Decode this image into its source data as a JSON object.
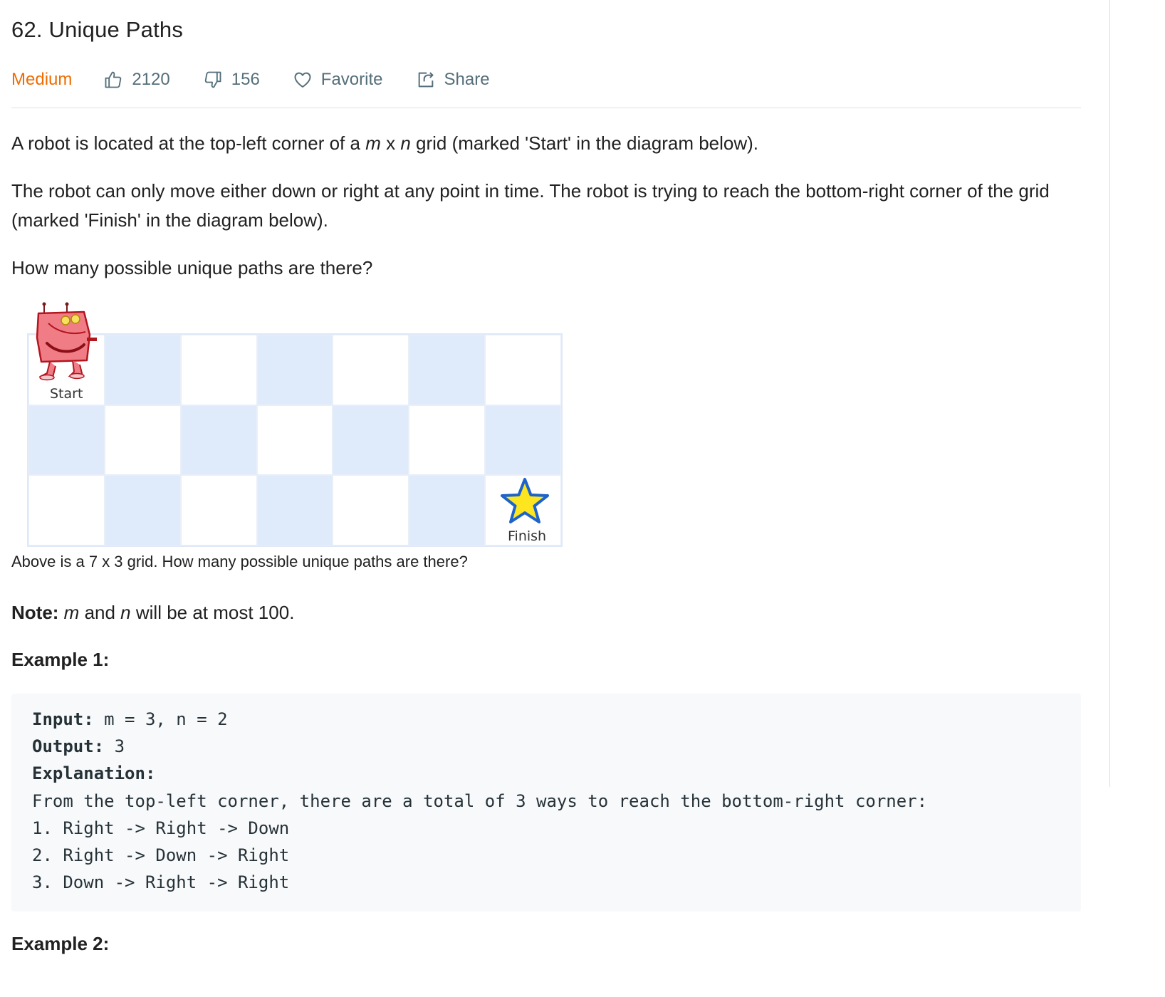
{
  "problem": {
    "title": "62. Unique Paths",
    "difficulty": "Medium",
    "likes": "2120",
    "dislikes": "156",
    "favorite_label": "Favorite",
    "share_label": "Share"
  },
  "description": {
    "p1_a": "A robot is located at the top-left corner of a ",
    "p1_m": "m",
    "p1_x": " x ",
    "p1_n": "n",
    "p1_b": " grid (marked 'Start' in the diagram below).",
    "p2": "The robot can only move either down or right at any point in time. The robot is trying to reach the bottom-right corner of the grid (marked 'Finish' in the diagram below).",
    "p3": "How many possible unique paths are there?"
  },
  "figure": {
    "start_label": "Start",
    "finish_label": "Finish",
    "columns": 7,
    "rows": 3,
    "caption": "Above is a 7 x 3 grid. How many possible unique paths are there?"
  },
  "note": {
    "label": "Note:",
    "m": "m",
    "and": " and ",
    "n": "n",
    "rest": " will be at most 100."
  },
  "example1": {
    "title": "Example 1:",
    "input_label": "Input:",
    "input_value": " m = 3, n = 2",
    "output_label": "Output:",
    "output_value": " 3",
    "explanation_label": "Explanation:",
    "lines": [
      "From the top-left corner, there are a total of 3 ways to reach the bottom-right corner:",
      "1. Right -> Right -> Down",
      "2. Right -> Down -> Right",
      "3. Down -> Right -> Right"
    ]
  },
  "example2": {
    "title": "Example 2:"
  },
  "colors": {
    "difficulty": "#ef6c00",
    "action_gray": "#546e7a",
    "grid_blue": "#dfeafb",
    "code_bg": "#f7f9fa"
  }
}
